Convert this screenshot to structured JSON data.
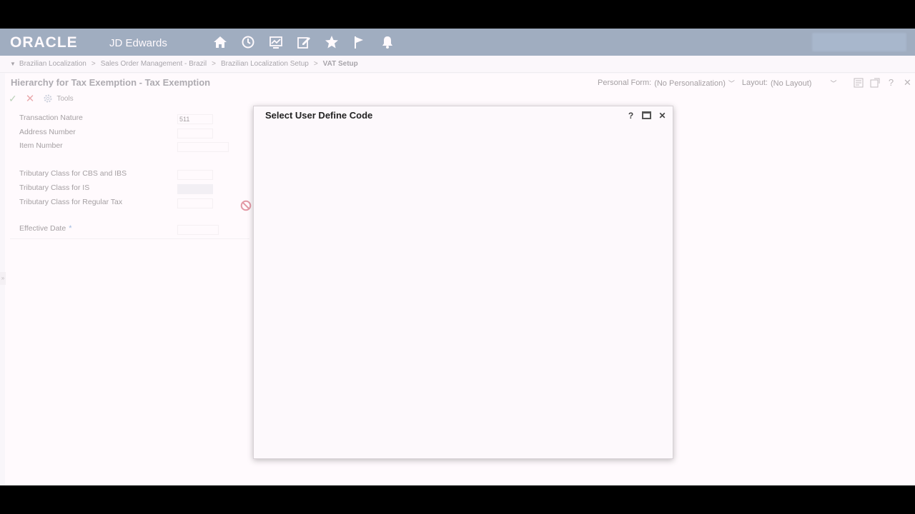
{
  "header": {
    "brand": "ORACLE",
    "brand_sub": "JD Edwards",
    "nav_icons": [
      "home-icon",
      "clock-icon",
      "chart-icon",
      "edit-icon",
      "star-icon",
      "flag-icon",
      "bell-icon"
    ]
  },
  "breadcrumb": {
    "items": [
      "Brazilian Localization",
      "Sales Order Management - Brazil",
      "Brazilian Localization Setup"
    ],
    "current": "VAT Setup",
    "separator": ">"
  },
  "form": {
    "title": "Hierarchy for Tax Exemption - Tax Exemption",
    "personal_form_label": "Personal Form:",
    "personal_form_value": "(No Personalization)",
    "layout_label": "Layout:",
    "layout_value": "(No Layout)",
    "tools_label": "Tools",
    "fields": {
      "transaction_nature": {
        "label": "Transaction Nature",
        "value": "511"
      },
      "address_number": {
        "label": "Address Number",
        "value": ""
      },
      "item_number": {
        "label": "Item Number",
        "value": ""
      },
      "tributary_cbs_ibs": {
        "label": "Tributary Class for CBS and IBS",
        "value": ""
      },
      "tributary_is": {
        "label": "Tributary Class for IS",
        "value": ""
      },
      "tributary_regular": {
        "label": "Tributary Class for Regular Tax",
        "value": ""
      },
      "effective_date": {
        "label": "Effective Date",
        "value": "",
        "required_marker": "*"
      }
    }
  },
  "modal": {
    "title": "Select User Define Code",
    "help_glyph": "?",
    "close_glyph": "✕"
  },
  "colors": {
    "header_bg": "#2d5478",
    "accent_blue": "#2f74c0",
    "block_red": "#c0283c"
  }
}
